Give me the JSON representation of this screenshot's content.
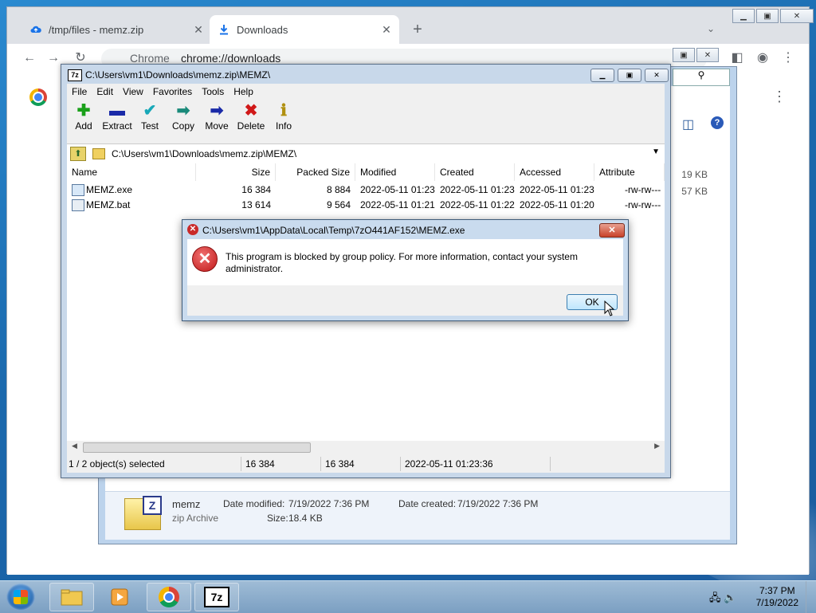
{
  "chrome": {
    "tabs": [
      {
        "label": "/tmp/files - memz.zip",
        "icon": "cloud-upload-icon"
      },
      {
        "label": "Downloads",
        "icon": "download-icon"
      }
    ],
    "omnibox": {
      "site": "Chrome",
      "url": "chrome://downloads"
    }
  },
  "explorer": {
    "sizes": [
      "19 KB",
      "57 KB"
    ],
    "details": {
      "name": "memz",
      "type": "zip Archive",
      "date_modified_label": "Date modified:",
      "date_modified": "7/19/2022 7:36 PM",
      "date_created_label": "Date created:",
      "date_created": "7/19/2022 7:36 PM",
      "size_label": "Size:",
      "size": "18.4 KB"
    }
  },
  "sevenzip": {
    "title": "C:\\Users\\vm1\\Downloads\\memz.zip\\MEMZ\\",
    "menu": [
      "File",
      "Edit",
      "View",
      "Favorites",
      "Tools",
      "Help"
    ],
    "tools": [
      {
        "label": "Add",
        "glyph": "✚",
        "color": "#1aa01a"
      },
      {
        "label": "Extract",
        "glyph": "▬",
        "color": "#1a2aa8"
      },
      {
        "label": "Test",
        "glyph": "✔",
        "color": "#18a8b8"
      },
      {
        "label": "Copy",
        "glyph": "➡",
        "color": "#1a8a7a"
      },
      {
        "label": "Move",
        "glyph": "➡",
        "color": "#1a2aa8"
      },
      {
        "label": "Delete",
        "glyph": "✖",
        "color": "#d01818"
      },
      {
        "label": "Info",
        "glyph": "ℹ",
        "color": "#b09010"
      }
    ],
    "address": "C:\\Users\\vm1\\Downloads\\memz.zip\\MEMZ\\",
    "columns": [
      "Name",
      "Size",
      "Packed Size",
      "Modified",
      "Created",
      "Accessed",
      "Attribute"
    ],
    "rows": [
      {
        "name": "MEMZ.exe",
        "size": "16 384",
        "packed": "8 884",
        "modified": "2022-05-11 01:23",
        "created": "2022-05-11 01:23",
        "accessed": "2022-05-11 01:23",
        "attr": "-rw-rw---"
      },
      {
        "name": "MEMZ.bat",
        "size": "13 614",
        "packed": "9 564",
        "modified": "2022-05-11 01:21",
        "created": "2022-05-11 01:22",
        "accessed": "2022-05-11 01:20",
        "attr": "-rw-rw---"
      }
    ],
    "status": {
      "selected": "1 / 2 object(s) selected",
      "size": "16 384",
      "packed": "16 384",
      "date": "2022-05-11 01:23:36"
    }
  },
  "dialog": {
    "title": "C:\\Users\\vm1\\AppData\\Local\\Temp\\7zO441AF152\\MEMZ.exe",
    "message": "This program is blocked by group policy. For more information, contact your system administrator.",
    "ok_label": "OK"
  },
  "taskbar": {
    "time": "7:37 PM",
    "date": "7/19/2022"
  }
}
